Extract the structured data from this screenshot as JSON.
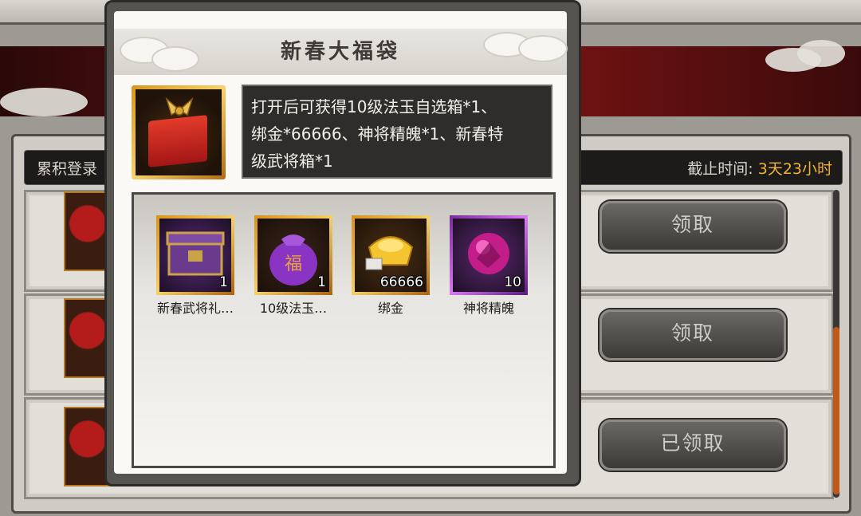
{
  "background": {
    "header_left": "累积登录",
    "deadline_label": "截止时间:",
    "deadline_value": "3天23小时",
    "rows": [
      {
        "button": "领取"
      },
      {
        "button": "领取"
      },
      {
        "button": "已领取"
      }
    ]
  },
  "dialog": {
    "title": "新春大福袋",
    "description_lines": [
      "打开后可获得10级法玉自选箱*1、",
      "绑金*66666、神将精魄*1、新春特",
      "级武将箱*1"
    ],
    "items": [
      {
        "name": "新春武将礼…",
        "count": "1",
        "icon": "chest-icon",
        "frame": "gold"
      },
      {
        "name": "10级法玉…",
        "count": "1",
        "icon": "fortune-bag-icon",
        "frame": "gold"
      },
      {
        "name": "绑金",
        "count": "66666",
        "icon": "gold-ingot-icon",
        "frame": "gold"
      },
      {
        "name": "神将精魄",
        "count": "10",
        "icon": "spirit-orb-icon",
        "frame": "purple"
      }
    ]
  },
  "colors": {
    "accent_gold": "#f2b233",
    "banner_red": "#7a1414"
  }
}
